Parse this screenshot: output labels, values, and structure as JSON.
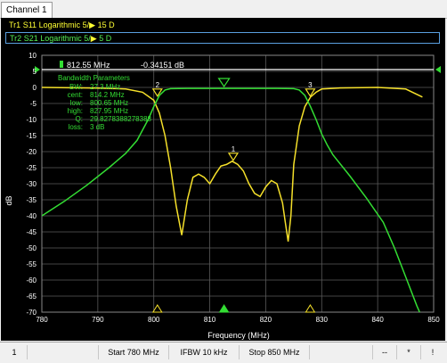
{
  "tab_label": "Channel 1",
  "traces": {
    "tr1": {
      "name": "Tr1",
      "param": "S11",
      "format": "Logarithmic",
      "scale": "5/",
      "ref": "15",
      "unit": "D"
    },
    "tr2": {
      "name": "Tr2",
      "param": "S21",
      "format": "Logarithmic",
      "scale": "5/",
      "ref": "5",
      "unit": "D"
    }
  },
  "marker_readout": {
    "freq": "812.55 MHz",
    "value": "-0.34151 dB"
  },
  "bandwidth_params": {
    "title": "Bandwidth Parameters",
    "rows": [
      {
        "label": "BW:",
        "value": "27.3 MHz"
      },
      {
        "label": "cent:",
        "value": "814.2 MHz"
      },
      {
        "label": "low:",
        "value": "800.65 MHz"
      },
      {
        "label": "high:",
        "value": "827.95 MHz"
      },
      {
        "label": "Q:",
        "value": "29.8278388278388"
      },
      {
        "label": "loss:",
        "value": "3 dB"
      }
    ]
  },
  "status_bar": {
    "channel": "1",
    "start": "Start 780 MHz",
    "ifbw": "IFBW 10 kHz",
    "stop": "Stop 850 MHz",
    "c1": "--",
    "c2": "*",
    "c3": "!"
  },
  "colors": {
    "s11": "#f5e02a",
    "s21": "#33dd33",
    "grid": "#5a5a5a",
    "text": "#ffffff"
  },
  "chart_data": {
    "type": "line",
    "xlabel": "Frequency (MHz)",
    "ylabel": "dB",
    "xlim": [
      780,
      850
    ],
    "ylim": [
      -70,
      10
    ],
    "xticks": [
      780,
      790,
      800,
      810,
      820,
      830,
      840,
      850
    ],
    "yticks": [
      10,
      5,
      0,
      -5,
      -10,
      -15,
      -20,
      -25,
      -30,
      -35,
      -40,
      -45,
      -50,
      -55,
      -60,
      -65,
      -70
    ],
    "grid": true,
    "series": [
      {
        "name": "S11",
        "color": "#f5e02a",
        "x": [
          780,
          790,
          795,
          798,
          800,
          801,
          802,
          803,
          804,
          805,
          806,
          807,
          808,
          809,
          810,
          811,
          812,
          813,
          814,
          815,
          816,
          817,
          818,
          819,
          820,
          821,
          822,
          823,
          823.5,
          824,
          824.5,
          825,
          826,
          827,
          828,
          829,
          830,
          833,
          840,
          845,
          848
        ],
        "y": [
          0,
          -0.2,
          -0.5,
          -1.5,
          -4,
          -8,
          -15,
          -25,
          -37,
          -46,
          -35,
          -28,
          -27,
          -28,
          -30,
          -27,
          -24.5,
          -24,
          -23,
          -24,
          -26,
          -30,
          -33,
          -34,
          -31,
          -29,
          -30,
          -36,
          -42,
          -48,
          -40,
          -24,
          -12,
          -6,
          -3,
          -1.5,
          -0.5,
          -0.2,
          0,
          -0.5,
          -3
        ]
      },
      {
        "name": "S21",
        "color": "#33dd33",
        "x": [
          780,
          784,
          788,
          792,
          795,
          797,
          799,
          800,
          801,
          802,
          803,
          806,
          810,
          814,
          818,
          822,
          825,
          826,
          827,
          828,
          829,
          830,
          831,
          832,
          835,
          838,
          841,
          843,
          845,
          847,
          848
        ],
        "y": [
          -40,
          -35.5,
          -30.5,
          -25,
          -20.5,
          -16.5,
          -10,
          -6,
          -2.5,
          -0.8,
          -0.4,
          -0.3,
          -0.3,
          -0.3,
          -0.3,
          -0.3,
          -0.4,
          -0.8,
          -2.5,
          -6,
          -10,
          -14.5,
          -18,
          -21,
          -27.5,
          -34.5,
          -42,
          -50,
          -59,
          -68,
          -72
        ]
      }
    ],
    "markers": [
      {
        "label": "1",
        "x": 814.2,
        "y": -23
      },
      {
        "label": "2",
        "x": 800.65,
        "y": -3
      },
      {
        "label": "3",
        "x": 827.95,
        "y": -3
      }
    ],
    "reference_markers": [
      {
        "x": 800.65
      },
      {
        "x": 812.55
      },
      {
        "x": 827.95
      }
    ]
  }
}
